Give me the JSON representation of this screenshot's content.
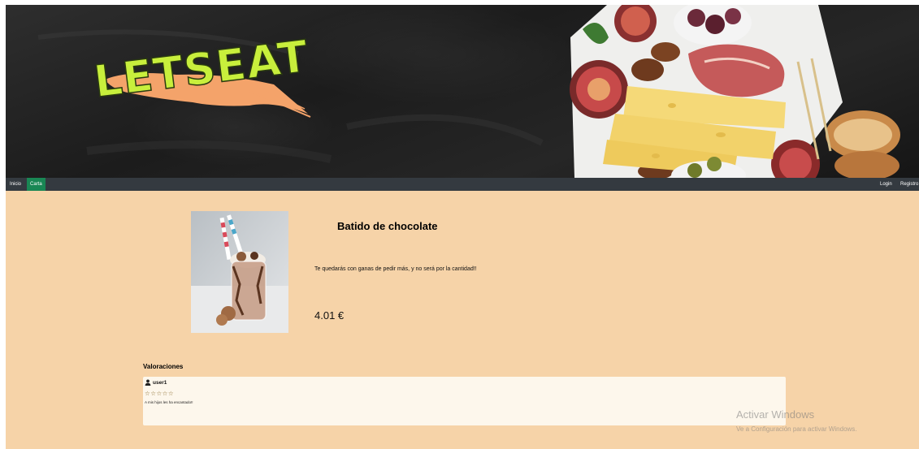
{
  "brand": {
    "logo_text": "LETSEAT"
  },
  "nav": {
    "left": [
      {
        "label": "Inicio",
        "active": false
      },
      {
        "label": "Carta",
        "active": true
      }
    ],
    "right": [
      {
        "label": "Login"
      },
      {
        "label": "Registro"
      }
    ]
  },
  "product": {
    "title": "Batido de chocolate",
    "description": "Te quedarás con ganas de pedir más, y no será por la cantidad!!",
    "price": "4.01 €"
  },
  "reviews": {
    "heading": "Valoraciones",
    "items": [
      {
        "user": "user1",
        "stars": "☆☆☆☆☆",
        "text": "A mis hijos les ha encantado!!"
      }
    ]
  },
  "watermark": {
    "title": "Activar Windows",
    "subtitle": "Ve a Configuración para activar Windows."
  },
  "colors": {
    "page_background": "#f6d3a8",
    "navbar": "#343a40",
    "active_nav": "#198754",
    "logo_green": "#c8ef3c",
    "logo_swash": "#f4a36a"
  }
}
